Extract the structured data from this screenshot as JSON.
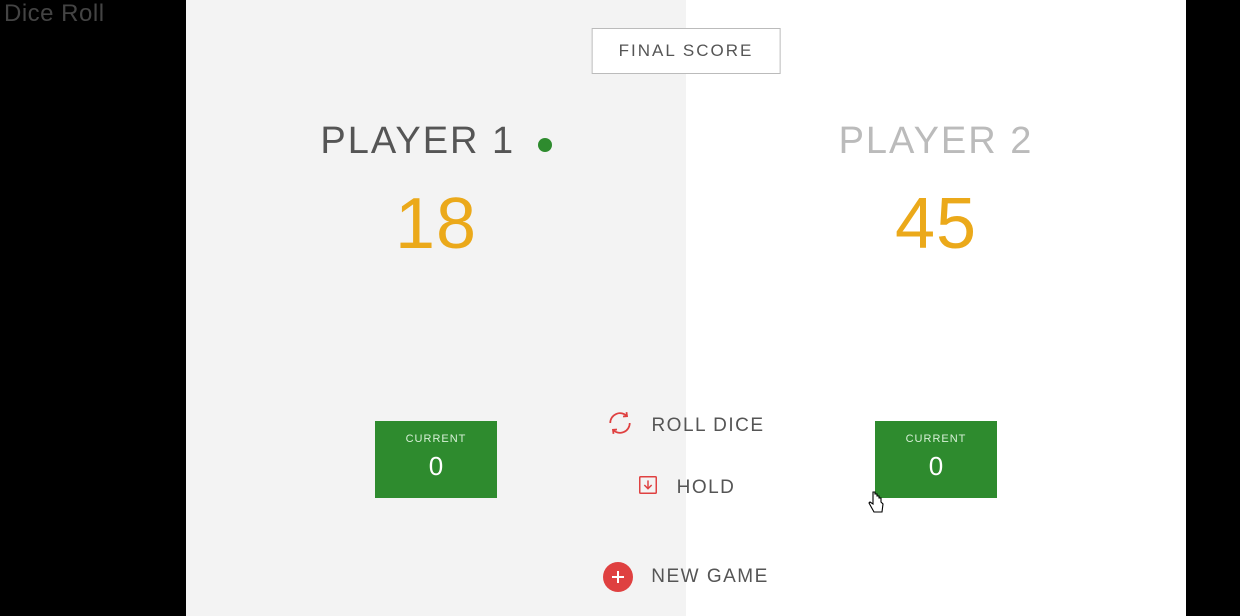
{
  "app_title": "Dice Roll",
  "final_score_label": "FINAL SCORE",
  "players": {
    "p1": {
      "name": "PLAYER 1",
      "score": "18",
      "current_label": "CURRENT",
      "current_score": "0",
      "active": true
    },
    "p2": {
      "name": "PLAYER 2",
      "score": "45",
      "current_label": "CURRENT",
      "current_score": "0",
      "active": false
    }
  },
  "controls": {
    "roll": "ROLL DICE",
    "hold": "HOLD",
    "new_game": "NEW GAME"
  },
  "colors": {
    "accent_orange": "#eba91a",
    "accent_green": "#2e8b2e",
    "accent_red": "#df4040"
  }
}
